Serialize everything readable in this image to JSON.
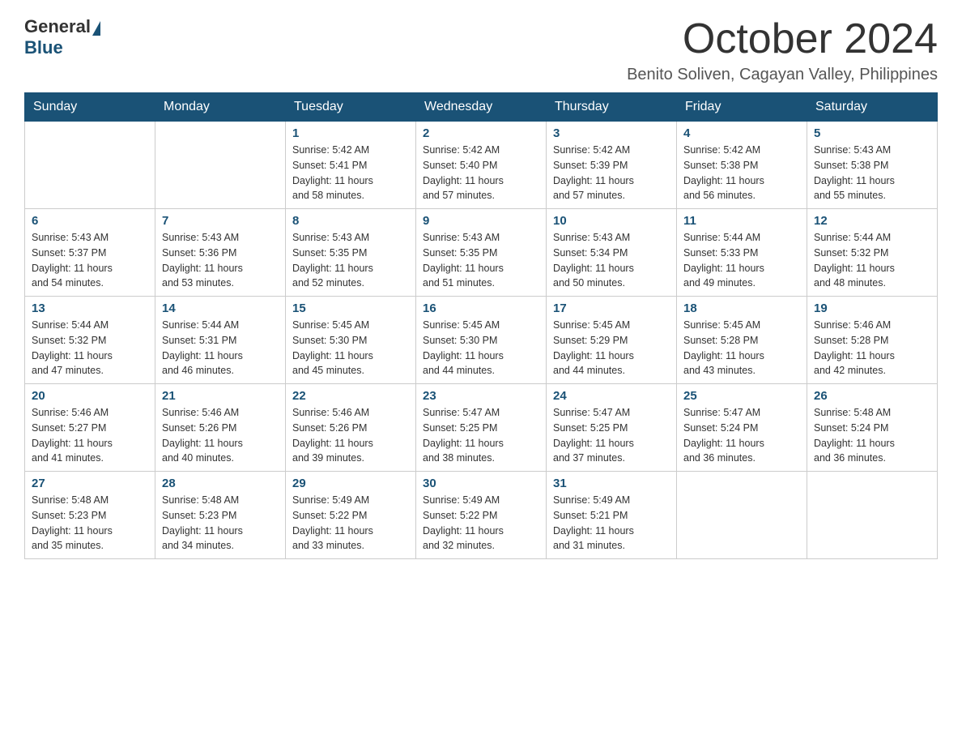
{
  "logo": {
    "general": "General",
    "blue": "Blue"
  },
  "header": {
    "month": "October 2024",
    "location": "Benito Soliven, Cagayan Valley, Philippines"
  },
  "weekdays": [
    "Sunday",
    "Monday",
    "Tuesday",
    "Wednesday",
    "Thursday",
    "Friday",
    "Saturday"
  ],
  "weeks": [
    [
      {
        "day": "",
        "info": ""
      },
      {
        "day": "",
        "info": ""
      },
      {
        "day": "1",
        "info": "Sunrise: 5:42 AM\nSunset: 5:41 PM\nDaylight: 11 hours\nand 58 minutes."
      },
      {
        "day": "2",
        "info": "Sunrise: 5:42 AM\nSunset: 5:40 PM\nDaylight: 11 hours\nand 57 minutes."
      },
      {
        "day": "3",
        "info": "Sunrise: 5:42 AM\nSunset: 5:39 PM\nDaylight: 11 hours\nand 57 minutes."
      },
      {
        "day": "4",
        "info": "Sunrise: 5:42 AM\nSunset: 5:38 PM\nDaylight: 11 hours\nand 56 minutes."
      },
      {
        "day": "5",
        "info": "Sunrise: 5:43 AM\nSunset: 5:38 PM\nDaylight: 11 hours\nand 55 minutes."
      }
    ],
    [
      {
        "day": "6",
        "info": "Sunrise: 5:43 AM\nSunset: 5:37 PM\nDaylight: 11 hours\nand 54 minutes."
      },
      {
        "day": "7",
        "info": "Sunrise: 5:43 AM\nSunset: 5:36 PM\nDaylight: 11 hours\nand 53 minutes."
      },
      {
        "day": "8",
        "info": "Sunrise: 5:43 AM\nSunset: 5:35 PM\nDaylight: 11 hours\nand 52 minutes."
      },
      {
        "day": "9",
        "info": "Sunrise: 5:43 AM\nSunset: 5:35 PM\nDaylight: 11 hours\nand 51 minutes."
      },
      {
        "day": "10",
        "info": "Sunrise: 5:43 AM\nSunset: 5:34 PM\nDaylight: 11 hours\nand 50 minutes."
      },
      {
        "day": "11",
        "info": "Sunrise: 5:44 AM\nSunset: 5:33 PM\nDaylight: 11 hours\nand 49 minutes."
      },
      {
        "day": "12",
        "info": "Sunrise: 5:44 AM\nSunset: 5:32 PM\nDaylight: 11 hours\nand 48 minutes."
      }
    ],
    [
      {
        "day": "13",
        "info": "Sunrise: 5:44 AM\nSunset: 5:32 PM\nDaylight: 11 hours\nand 47 minutes."
      },
      {
        "day": "14",
        "info": "Sunrise: 5:44 AM\nSunset: 5:31 PM\nDaylight: 11 hours\nand 46 minutes."
      },
      {
        "day": "15",
        "info": "Sunrise: 5:45 AM\nSunset: 5:30 PM\nDaylight: 11 hours\nand 45 minutes."
      },
      {
        "day": "16",
        "info": "Sunrise: 5:45 AM\nSunset: 5:30 PM\nDaylight: 11 hours\nand 44 minutes."
      },
      {
        "day": "17",
        "info": "Sunrise: 5:45 AM\nSunset: 5:29 PM\nDaylight: 11 hours\nand 44 minutes."
      },
      {
        "day": "18",
        "info": "Sunrise: 5:45 AM\nSunset: 5:28 PM\nDaylight: 11 hours\nand 43 minutes."
      },
      {
        "day": "19",
        "info": "Sunrise: 5:46 AM\nSunset: 5:28 PM\nDaylight: 11 hours\nand 42 minutes."
      }
    ],
    [
      {
        "day": "20",
        "info": "Sunrise: 5:46 AM\nSunset: 5:27 PM\nDaylight: 11 hours\nand 41 minutes."
      },
      {
        "day": "21",
        "info": "Sunrise: 5:46 AM\nSunset: 5:26 PM\nDaylight: 11 hours\nand 40 minutes."
      },
      {
        "day": "22",
        "info": "Sunrise: 5:46 AM\nSunset: 5:26 PM\nDaylight: 11 hours\nand 39 minutes."
      },
      {
        "day": "23",
        "info": "Sunrise: 5:47 AM\nSunset: 5:25 PM\nDaylight: 11 hours\nand 38 minutes."
      },
      {
        "day": "24",
        "info": "Sunrise: 5:47 AM\nSunset: 5:25 PM\nDaylight: 11 hours\nand 37 minutes."
      },
      {
        "day": "25",
        "info": "Sunrise: 5:47 AM\nSunset: 5:24 PM\nDaylight: 11 hours\nand 36 minutes."
      },
      {
        "day": "26",
        "info": "Sunrise: 5:48 AM\nSunset: 5:24 PM\nDaylight: 11 hours\nand 36 minutes."
      }
    ],
    [
      {
        "day": "27",
        "info": "Sunrise: 5:48 AM\nSunset: 5:23 PM\nDaylight: 11 hours\nand 35 minutes."
      },
      {
        "day": "28",
        "info": "Sunrise: 5:48 AM\nSunset: 5:23 PM\nDaylight: 11 hours\nand 34 minutes."
      },
      {
        "day": "29",
        "info": "Sunrise: 5:49 AM\nSunset: 5:22 PM\nDaylight: 11 hours\nand 33 minutes."
      },
      {
        "day": "30",
        "info": "Sunrise: 5:49 AM\nSunset: 5:22 PM\nDaylight: 11 hours\nand 32 minutes."
      },
      {
        "day": "31",
        "info": "Sunrise: 5:49 AM\nSunset: 5:21 PM\nDaylight: 11 hours\nand 31 minutes."
      },
      {
        "day": "",
        "info": ""
      },
      {
        "day": "",
        "info": ""
      }
    ]
  ]
}
